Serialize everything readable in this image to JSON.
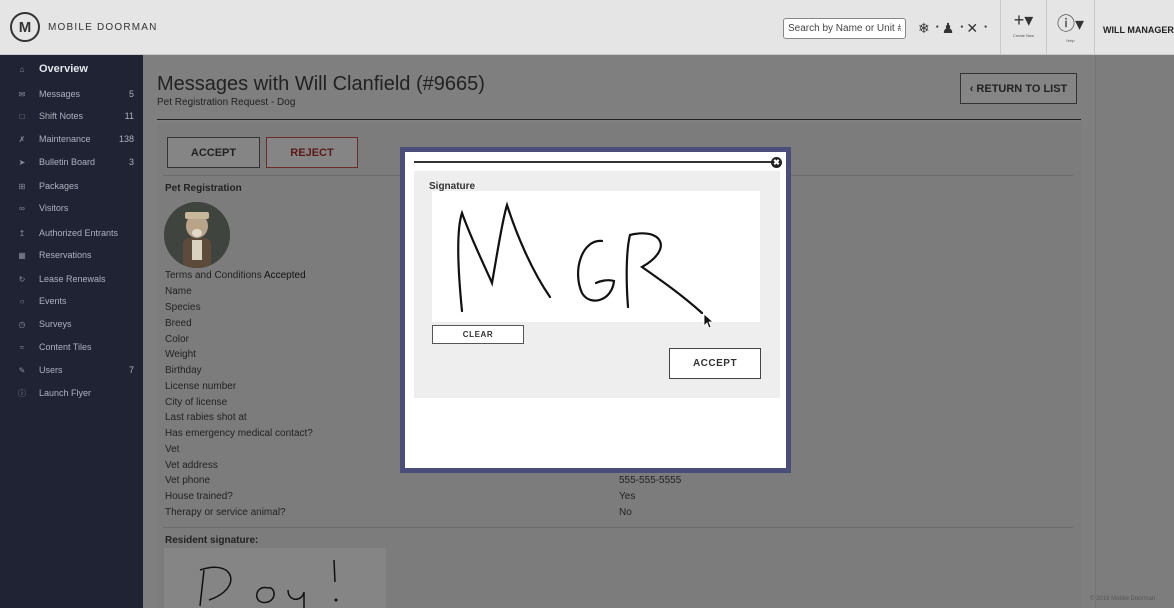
{
  "header": {
    "logo_letter": "M",
    "brand": "MOBILE DOORMAN",
    "search_placeholder": "Search by Name or Unit #",
    "create_label": "Create New",
    "help_label": "Help",
    "user_name": "WILL MANAGER -"
  },
  "sidebar": {
    "items": [
      {
        "label": "Overview",
        "icon": "home-icon",
        "count": ""
      },
      {
        "label": "Messages",
        "icon": "envelope-icon",
        "count": "5"
      },
      {
        "label": "Shift Notes",
        "icon": "note-icon",
        "count": "11"
      },
      {
        "label": "Maintenance",
        "icon": "wrench-icon",
        "count": "138"
      },
      {
        "label": "Bulletin Board",
        "icon": "pin-icon",
        "count": "3"
      },
      {
        "label": "Packages",
        "icon": "package-icon",
        "count": ""
      },
      {
        "label": "Visitors",
        "icon": "visitors-icon",
        "count": ""
      },
      {
        "label": "Authorized Entrants",
        "icon": "key-icon",
        "count": ""
      },
      {
        "label": "Reservations",
        "icon": "calendar-icon",
        "count": ""
      },
      {
        "label": "Lease Renewals",
        "icon": "refresh-icon",
        "count": ""
      },
      {
        "label": "Events",
        "icon": "ticket-icon",
        "count": ""
      },
      {
        "label": "Surveys",
        "icon": "clock-icon",
        "count": ""
      },
      {
        "label": "Content Tiles",
        "icon": "tiles-icon",
        "count": ""
      },
      {
        "label": "Users",
        "icon": "user-icon",
        "count": "7"
      },
      {
        "label": "Launch Flyer",
        "icon": "info-icon",
        "count": ""
      }
    ]
  },
  "page": {
    "title": "Messages with Will Clanfield (#9665)",
    "subtitle": "Pet Registration Request - Dog",
    "return_label": "‹ RETURN TO LIST",
    "accept_label": "ACCEPT",
    "reject_label": "REJECT",
    "section_title": "Pet Registration",
    "terms_label": "Terms and Conditions",
    "terms_value": "Accepted",
    "fields": [
      {
        "label": "Name",
        "value": ""
      },
      {
        "label": "Species",
        "value": ""
      },
      {
        "label": "Breed",
        "value": ""
      },
      {
        "label": "Color",
        "value": ""
      },
      {
        "label": "Weight",
        "value": ""
      },
      {
        "label": "Birthday",
        "value": ""
      },
      {
        "label": "License number",
        "value": ""
      },
      {
        "label": "City of license",
        "value": ""
      },
      {
        "label": "Last rabies shot at",
        "value": ""
      },
      {
        "label": "Has emergency medical contact?",
        "value": ""
      },
      {
        "label": "Vet",
        "value": ""
      },
      {
        "label": "Vet address",
        "value": ""
      },
      {
        "label": "Vet phone",
        "value": "555-555-5555"
      },
      {
        "label": "House trained?",
        "value": "Yes"
      },
      {
        "label": "Therapy or service animal?",
        "value": "No"
      }
    ],
    "resident_signature_label": "Resident signature:",
    "copyright": "© 2018 Mobile Doorman"
  },
  "modal": {
    "signature_label": "Signature",
    "clear_label": "CLEAR",
    "accept_label": "ACCEPT",
    "close_glyph": "✖"
  },
  "colors": {
    "sidebar_bg": "#1f2333",
    "modal_border": "#4b4e7a",
    "reject_text": "#5b1818"
  }
}
